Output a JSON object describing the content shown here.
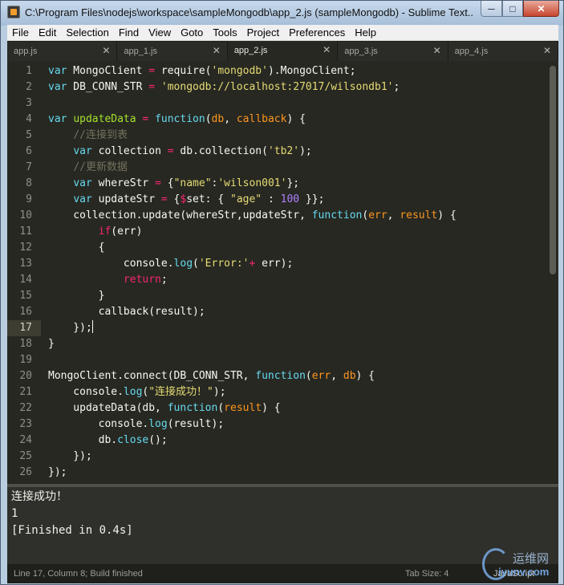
{
  "window": {
    "title": "C:\\Program Files\\nodejs\\workspace\\sampleMongodb\\app_2.js (sampleMongodb) - Sublime Text...",
    "minimize_glyph": "─",
    "maximize_glyph": "□",
    "close_glyph": "✕"
  },
  "menu": {
    "items": [
      "File",
      "Edit",
      "Selection",
      "Find",
      "View",
      "Goto",
      "Tools",
      "Project",
      "Preferences",
      "Help"
    ]
  },
  "tabs": [
    {
      "label": "app.js",
      "active": false,
      "close_glyph": "✕"
    },
    {
      "label": "app_1.js",
      "active": false,
      "close_glyph": "✕"
    },
    {
      "label": "app_2.js",
      "active": true,
      "close_glyph": "✕"
    },
    {
      "label": "app_3.js",
      "active": false,
      "close_glyph": "✕"
    },
    {
      "label": "app_4.js",
      "active": false,
      "close_glyph": "✕"
    }
  ],
  "editor": {
    "current_line": 17,
    "lines": [
      {
        "n": "1",
        "text": "var MongoClient = require('mongodb').MongoClient;"
      },
      {
        "n": "2",
        "text": "var DB_CONN_STR = 'mongodb://localhost:27017/wilsondb1';"
      },
      {
        "n": "3",
        "text": ""
      },
      {
        "n": "4",
        "text": "var updateData = function(db, callback) {"
      },
      {
        "n": "5",
        "text": "    //连接到表"
      },
      {
        "n": "6",
        "text": "    var collection = db.collection('tb2');"
      },
      {
        "n": "7",
        "text": "    //更新数据"
      },
      {
        "n": "8",
        "text": "    var whereStr = {\"name\":'wilson001'};"
      },
      {
        "n": "9",
        "text": "    var updateStr = {$set: { \"age\" : 100 }};"
      },
      {
        "n": "10",
        "text": "    collection.update(whereStr,updateStr, function(err, result) {"
      },
      {
        "n": "11",
        "text": "        if(err)"
      },
      {
        "n": "12",
        "text": "        {"
      },
      {
        "n": "13",
        "text": "            console.log('Error:'+ err);"
      },
      {
        "n": "14",
        "text": "            return;"
      },
      {
        "n": "15",
        "text": "        }"
      },
      {
        "n": "16",
        "text": "        callback(result);"
      },
      {
        "n": "17",
        "text": "    });"
      },
      {
        "n": "18",
        "text": "}"
      },
      {
        "n": "19",
        "text": ""
      },
      {
        "n": "20",
        "text": "MongoClient.connect(DB_CONN_STR, function(err, db) {"
      },
      {
        "n": "21",
        "text": "    console.log(\"连接成功！\");"
      },
      {
        "n": "22",
        "text": "    updateData(db, function(result) {"
      },
      {
        "n": "23",
        "text": "        console.log(result);"
      },
      {
        "n": "24",
        "text": "        db.close();"
      },
      {
        "n": "25",
        "text": "    });"
      },
      {
        "n": "26",
        "text": "});"
      }
    ]
  },
  "output": {
    "lines": [
      "连接成功！",
      "1",
      "[Finished in 0.4s]"
    ]
  },
  "status": {
    "left": "Line 17, Column 8; Build finished",
    "tab_size": "Tab Size: 4",
    "syntax": "JavaScript"
  },
  "watermark": {
    "text1": "运维网",
    "text2": "iyunv.com"
  },
  "colors": {
    "editor_bg": "#272822",
    "keyword": "#66d9ef",
    "storage": "#f92672",
    "string": "#e6db74",
    "number": "#ae81ff",
    "function_name": "#a6e22e",
    "parameter": "#fd971f",
    "comment": "#75715e"
  }
}
